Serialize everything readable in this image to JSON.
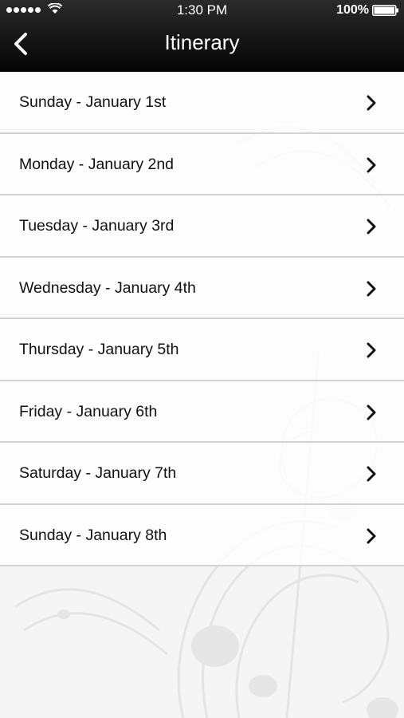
{
  "status_bar": {
    "time": "1:30 PM",
    "battery_percent": "100%",
    "signal_icon": "signal-dots-icon",
    "wifi_icon": "wifi-icon",
    "battery_icon": "battery-icon"
  },
  "nav": {
    "title": "Itinerary",
    "back_icon": "chevron-left-icon"
  },
  "itinerary": {
    "items": [
      {
        "label": "Sunday - January 1st"
      },
      {
        "label": "Monday - January 2nd"
      },
      {
        "label": "Tuesday - January 3rd"
      },
      {
        "label": "Wednesday - January 4th"
      },
      {
        "label": "Thursday - January 5th"
      },
      {
        "label": "Friday - January 6th"
      },
      {
        "label": "Saturday - January 7th"
      },
      {
        "label": "Sunday - January 8th"
      }
    ],
    "chevron_icon": "chevron-right-icon"
  },
  "colors": {
    "header_bg": "#111111",
    "header_text": "#ffffff",
    "row_text": "#111111",
    "divider": "#d2d2d2"
  }
}
